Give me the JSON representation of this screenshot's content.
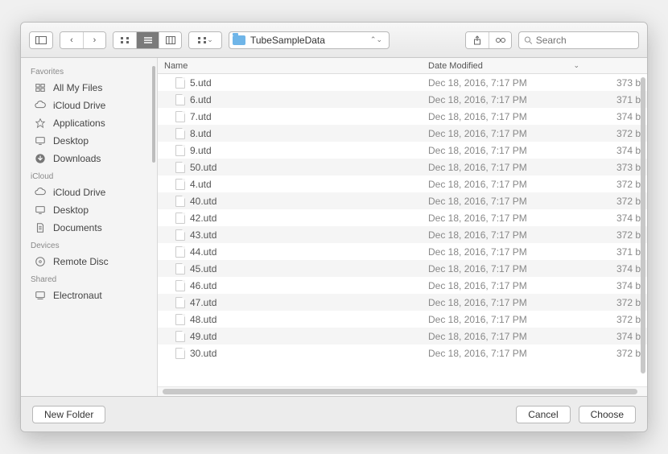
{
  "toolbar": {
    "path": "TubeSampleData",
    "search_placeholder": "Search"
  },
  "sidebar": {
    "sections": [
      {
        "title": "Favorites",
        "items": [
          {
            "icon": "all-files",
            "label": "All My Files"
          },
          {
            "icon": "cloud",
            "label": "iCloud Drive"
          },
          {
            "icon": "apps",
            "label": "Applications"
          },
          {
            "icon": "desktop",
            "label": "Desktop"
          },
          {
            "icon": "downloads",
            "label": "Downloads"
          }
        ]
      },
      {
        "title": "iCloud",
        "items": [
          {
            "icon": "cloud",
            "label": "iCloud Drive"
          },
          {
            "icon": "desktop",
            "label": "Desktop"
          },
          {
            "icon": "documents",
            "label": "Documents"
          }
        ]
      },
      {
        "title": "Devices",
        "items": [
          {
            "icon": "disc",
            "label": "Remote Disc"
          }
        ]
      },
      {
        "title": "Shared",
        "items": [
          {
            "icon": "computer",
            "label": "Electronaut"
          }
        ]
      }
    ]
  },
  "columns": {
    "name": "Name",
    "date": "Date Modified",
    "size": ""
  },
  "files": [
    {
      "name": "5.utd",
      "date": "Dec 18, 2016, 7:17 PM",
      "size": "373 b"
    },
    {
      "name": "6.utd",
      "date": "Dec 18, 2016, 7:17 PM",
      "size": "371 b"
    },
    {
      "name": "7.utd",
      "date": "Dec 18, 2016, 7:17 PM",
      "size": "374 b"
    },
    {
      "name": "8.utd",
      "date": "Dec 18, 2016, 7:17 PM",
      "size": "372 b"
    },
    {
      "name": "9.utd",
      "date": "Dec 18, 2016, 7:17 PM",
      "size": "374 b"
    },
    {
      "name": "50.utd",
      "date": "Dec 18, 2016, 7:17 PM",
      "size": "373 b"
    },
    {
      "name": "4.utd",
      "date": "Dec 18, 2016, 7:17 PM",
      "size": "372 b"
    },
    {
      "name": "40.utd",
      "date": "Dec 18, 2016, 7:17 PM",
      "size": "372 b"
    },
    {
      "name": "42.utd",
      "date": "Dec 18, 2016, 7:17 PM",
      "size": "374 b"
    },
    {
      "name": "43.utd",
      "date": "Dec 18, 2016, 7:17 PM",
      "size": "372 b"
    },
    {
      "name": "44.utd",
      "date": "Dec 18, 2016, 7:17 PM",
      "size": "371 b"
    },
    {
      "name": "45.utd",
      "date": "Dec 18, 2016, 7:17 PM",
      "size": "374 b"
    },
    {
      "name": "46.utd",
      "date": "Dec 18, 2016, 7:17 PM",
      "size": "374 b"
    },
    {
      "name": "47.utd",
      "date": "Dec 18, 2016, 7:17 PM",
      "size": "372 b"
    },
    {
      "name": "48.utd",
      "date": "Dec 18, 2016, 7:17 PM",
      "size": "372 b"
    },
    {
      "name": "49.utd",
      "date": "Dec 18, 2016, 7:17 PM",
      "size": "374 b"
    },
    {
      "name": "30.utd",
      "date": "Dec 18, 2016, 7:17 PM",
      "size": "372 b"
    }
  ],
  "footer": {
    "new_folder": "New Folder",
    "cancel": "Cancel",
    "choose": "Choose"
  },
  "icons": {
    "all-files": "<svg viewBox='0 0 16 16'><rect x='2' y='3' width='5' height='4' fill='none' stroke-width='1.2'/><rect x='9' y='3' width='5' height='4' fill='none' stroke-width='1.2'/><rect x='2' y='9' width='5' height='4' fill='none' stroke-width='1.2'/><rect x='9' y='9' width='5' height='4' fill='none' stroke-width='1.2'/></svg>",
    "cloud": "<svg viewBox='0 0 16 16'><path d='M4 11a3 3 0 010-6 4 4 0 017.5-1A3 3 0 0112 11z' fill='none' stroke-width='1.2'/></svg>",
    "apps": "<svg viewBox='0 0 16 16'><path d='M8 2l2 4h4l-3 3 1 5-4-3-4 3 1-5-3-3h4z' fill='none' stroke-width='1'/></svg>",
    "desktop": "<svg viewBox='0 0 16 16'><rect x='2' y='3' width='12' height='8' rx='1' fill='none' stroke-width='1.2'/><path d='M6 13h4' stroke-width='1.2'/></svg>",
    "downloads": "<svg viewBox='0 0 16 16'><circle cx='8' cy='8' r='6' fill='#777'/><path d='M8 4v5M5 7l3 3 3-3' stroke='#fff' fill='none' stroke-width='1.4'/></svg>",
    "documents": "<svg viewBox='0 0 16 16'><path d='M4 2h6l2 2v10H4z' fill='none' stroke-width='1.2'/><path d='M6 6h4M6 8h4M6 10h4' stroke-width='1'/></svg>",
    "disc": "<svg viewBox='0 0 16 16'><circle cx='8' cy='8' r='6' fill='none' stroke-width='1.2'/><circle cx='8' cy='8' r='1.5' fill='none' stroke-width='1'/></svg>",
    "computer": "<svg viewBox='0 0 16 16'><rect x='2' y='3' width='12' height='8' rx='1' fill='none' stroke-width='1.2'/><path d='M4 13h8' stroke-width='1.2'/></svg>"
  }
}
